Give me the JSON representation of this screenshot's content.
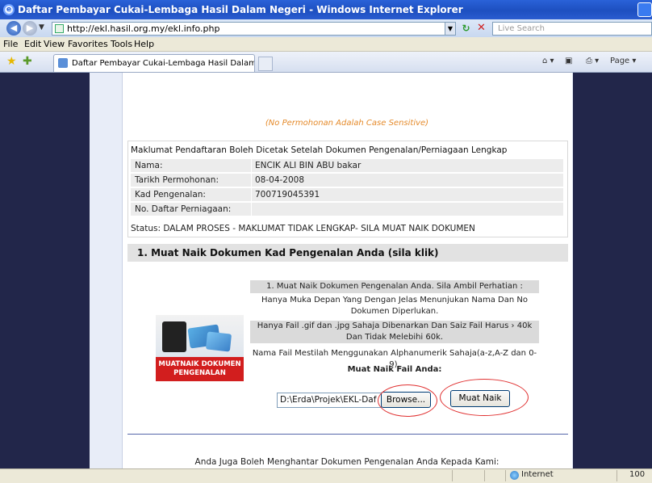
{
  "window": {
    "title": "Daftar Pembayar Cukai-Lembaga Hasil Dalam Negeri - Windows Internet Explorer"
  },
  "addressbar": {
    "url": "http://ekl.hasil.org.my/ekl.info.php",
    "search_placeholder": "Live Search"
  },
  "menu": [
    {
      "label": "File"
    },
    {
      "label": "Edit"
    },
    {
      "label": "View"
    },
    {
      "label": "Favorites"
    },
    {
      "label": "Tools"
    },
    {
      "label": "Help"
    }
  ],
  "tab": {
    "label": "Daftar Pembayar Cukai-Lembaga Hasil Dalam Negeri"
  },
  "toolbar": {
    "page_label": "Page"
  },
  "page": {
    "case_note": "(No Permohonan Adalah Case Sensitive)",
    "info_header": "Maklumat Pendaftaran Boleh Dicetak Setelah Dokumen Pengenalan/Perniagaan Lengkap",
    "fields": [
      {
        "label": "Nama:",
        "value": "ENCIK ALI BIN ABU bakar"
      },
      {
        "label": "Tarikh Permohonan:",
        "value": "08-04-2008"
      },
      {
        "label": "Kad Pengenalan:",
        "value": "700719045391"
      },
      {
        "label": "No. Daftar Perniagaan:",
        "value": ""
      }
    ],
    "status": "Status: DALAM PROSES - MAKLUMAT TIDAK LENGKAP- SILA MUAT NAIK DOKUMEN",
    "section_title": "1. Muat Naik Dokumen Kad Pengenalan Anda  (sila klik)",
    "instructions": {
      "heading": "1. Muat Naik Dokumen Pengenalan Anda. Sila Ambil Perhatian :",
      "line1": "Hanya Muka Depan Yang Dengan Jelas Menunjukan Nama Dan No Dokumen Diperlukan.",
      "line2": "Hanya Fail .gif dan .jpg Sahaja Dibenarkan Dan Saiz Fail Harus › 40k Dan Tidak Melebihi 60k.",
      "line3": "Nama Fail Mestilah Menggunakan Alphanumerik Sahaja(a-z,A-Z dan 0-9).",
      "file_label": "Muat Naik Fail Anda:"
    },
    "image_caption": "MUATNAIK DOKUMEN PENGENALAN",
    "file_value": "D:\\Erda\\Projek\\EKL-Daf",
    "browse_label": "Browse...",
    "upload_label": "Muat Naik",
    "bottom_text": "Anda Juga Boleh Menghantar Dokumen Pengenalan Anda Kepada Kami:"
  },
  "statusbar": {
    "zone": "Internet",
    "zoom": "100"
  },
  "colors": {
    "titlebar": "#1d4fc0",
    "page_bg": "#22264a",
    "note_orange": "#e58a2a",
    "image_red": "#d21e1e",
    "annotation_red": "#e03030"
  }
}
